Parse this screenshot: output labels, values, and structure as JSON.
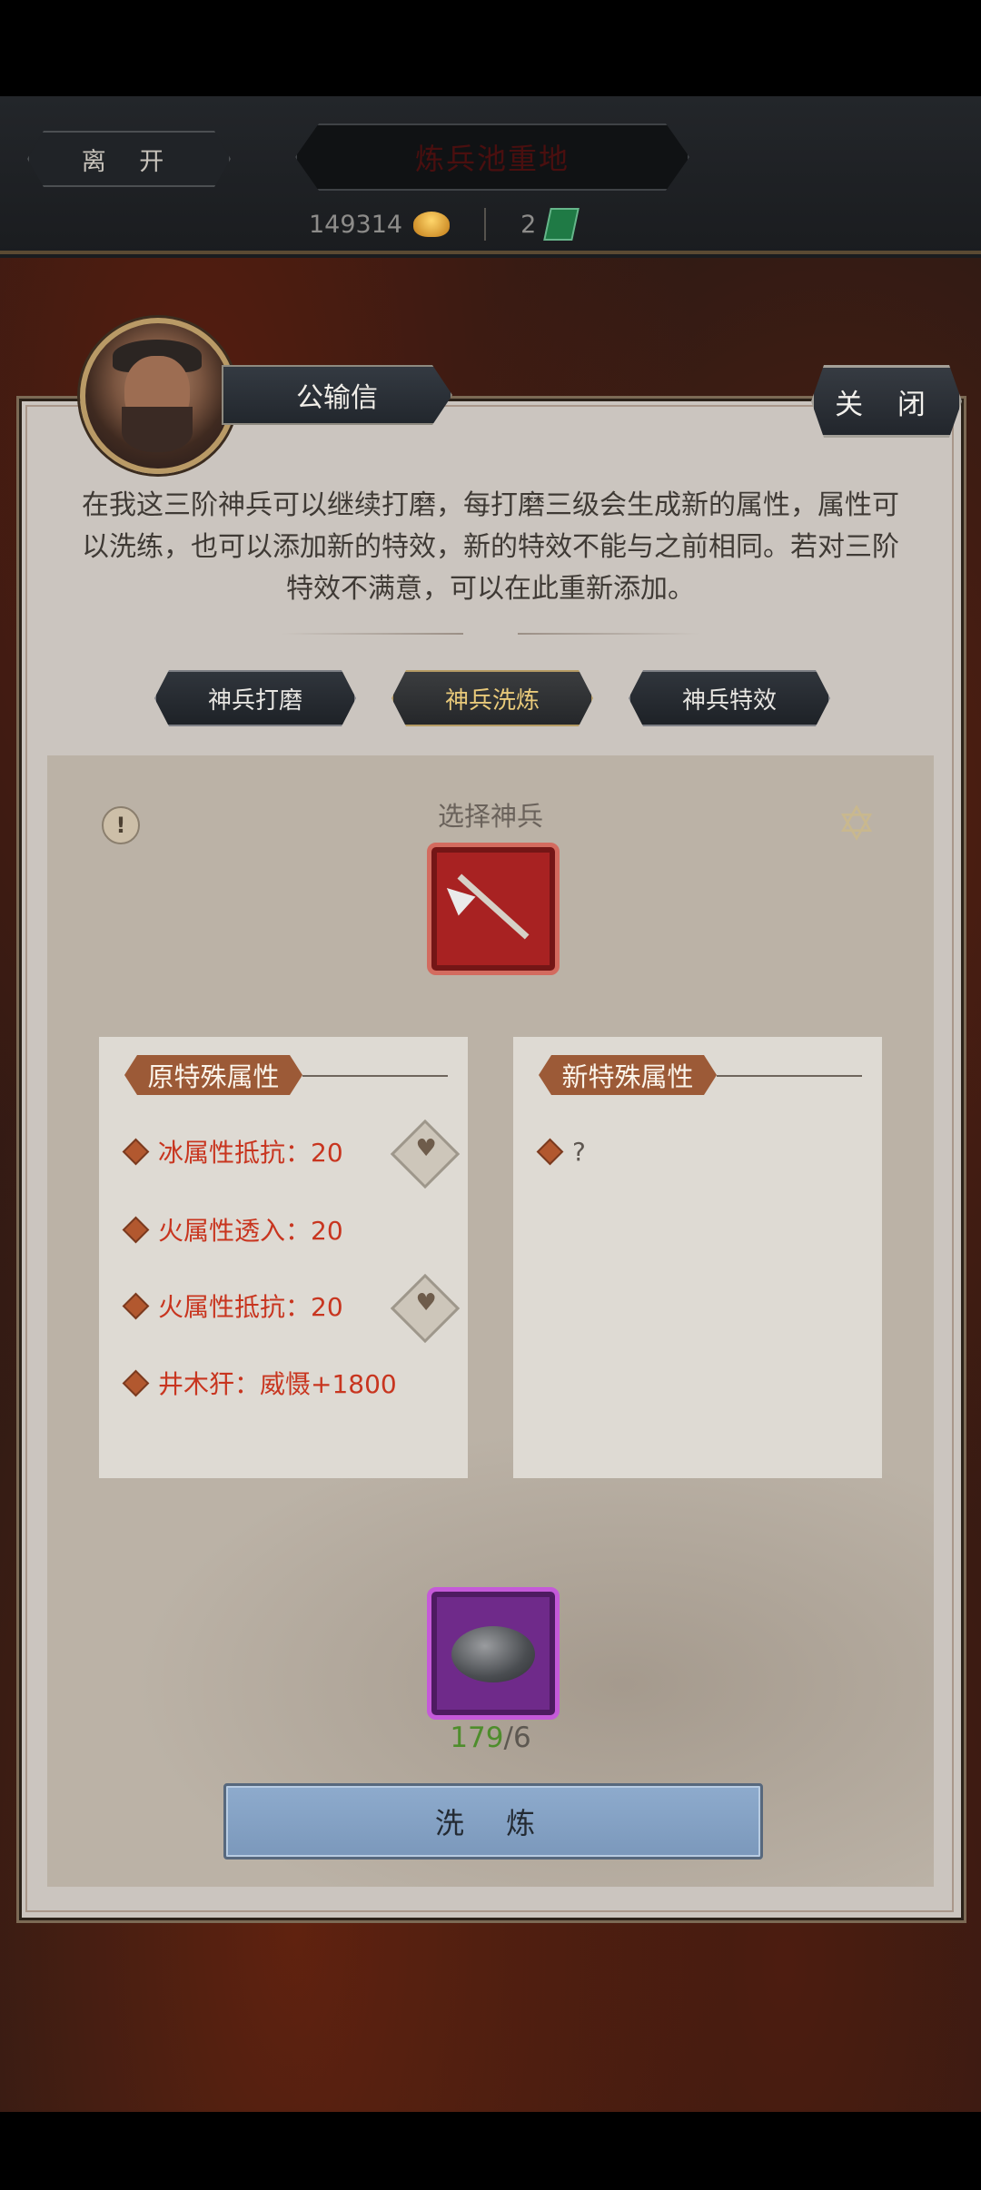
{
  "header": {
    "leave_label": "离 开",
    "title": "炼兵池重地",
    "gold_amount": "149314",
    "jade_amount": "2"
  },
  "npc": {
    "name": "公输信",
    "close_label": "关 闭",
    "description": "在我这三阶神兵可以继续打磨，每打磨三级会生成新的属性，属性可以洗练，也可以添加新的特效，新的特效不能与之前相同。若对三阶特效不满意，可以在此重新添加。"
  },
  "tabs": [
    {
      "label": "神兵打磨",
      "active": false
    },
    {
      "label": "神兵洗炼",
      "active": true
    },
    {
      "label": "神兵特效",
      "active": false
    }
  ],
  "panel": {
    "select_label": "选择神兵",
    "info_symbol": "!",
    "star_symbol": "✡",
    "old_attr_title": "原特殊属性",
    "new_attr_title": "新特殊属性",
    "old_attrs": [
      {
        "text": "冰属性抵抗：20",
        "locked": true
      },
      {
        "text": "火属性透入：20",
        "locked": false
      },
      {
        "text": "火属性抵抗：20",
        "locked": true
      },
      {
        "text": "井木犴：威慑+1800",
        "locked": false
      }
    ],
    "new_attrs": [
      {
        "text": "?"
      }
    ],
    "stone_have": "179",
    "stone_need": "/6",
    "wash_label": "洗 炼"
  },
  "colors": {
    "attr_text": "#c8351f",
    "have_count": "#4e8d2c",
    "wash_button": "#8eabcd"
  }
}
